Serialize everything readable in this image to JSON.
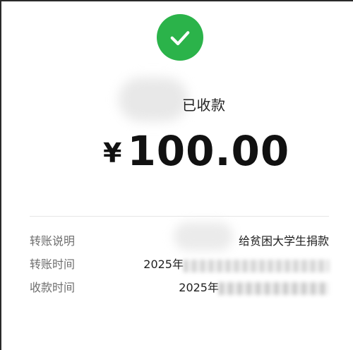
{
  "status": {
    "icon": "check-icon",
    "text_visible": "已收款"
  },
  "amount": {
    "currency_symbol": "¥",
    "value": "100.00"
  },
  "details": [
    {
      "label": "转账说明",
      "value": "给贫困大学生捐款"
    },
    {
      "label": "转账时间",
      "value": "2025年"
    },
    {
      "label": "收款时间",
      "value": "2025年"
    }
  ],
  "colors": {
    "success_green": "#2bb34a",
    "text_primary": "#111111",
    "text_secondary": "#6e6e6e",
    "divider": "#e6e6e6",
    "background": "#ffffff"
  }
}
